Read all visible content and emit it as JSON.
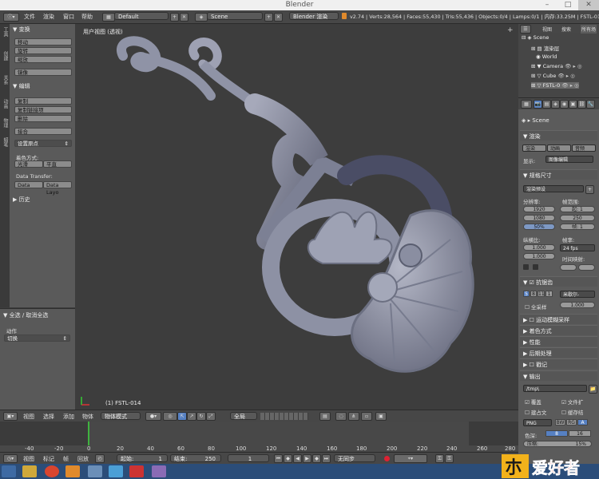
{
  "window": {
    "title": "Blender"
  },
  "info_header": {
    "menus": [
      "文件",
      "渲染",
      "窗口",
      "帮助"
    ],
    "screen_layout": "Default",
    "scene": "Scene",
    "render_engine": "Blender 渲染",
    "stats": "v2.74 | Verts:28,564 | Faces:55,430 | Tris:55,436 | Objects:0/4 | Lamps:0/1 | 内存:33.25M | FSTL-014"
  },
  "toolshelf": {
    "tabs": [
      "工具",
      "创建",
      "关系",
      "动画",
      "物理",
      "蜡笔"
    ],
    "transform": {
      "header": "变换",
      "buttons": [
        "移动",
        "旋转",
        "缩放"
      ],
      "mirror": "镜像"
    },
    "edit": {
      "header": "编辑",
      "buttons": [
        "复制",
        "复制链接项",
        "删除"
      ],
      "join": "接合",
      "set_origin": "设置原点",
      "shading_label": "着色方式:",
      "smooth": "光滑",
      "flat": "平直",
      "data_transfer_label": "Data Transfer:",
      "data": "Data",
      "data_layout": "Data Layo"
    },
    "history": {
      "header": "历史"
    }
  },
  "operator": {
    "title": "全选 / 取消全选",
    "action_label": "动作",
    "action_value": "切换"
  },
  "viewport": {
    "title": "用户视图 (透视)",
    "object_label": "(1) FSTL-014"
  },
  "viewport_header": {
    "menus": [
      "视图",
      "选择",
      "添加",
      "物体"
    ],
    "mode": "物体模式",
    "pivot": "全局"
  },
  "timeline": {
    "ticks": [
      "-40",
      "-20",
      "0",
      "20",
      "40",
      "60",
      "80",
      "100",
      "120",
      "140",
      "160",
      "180",
      "200",
      "220",
      "240",
      "260",
      "280"
    ],
    "menus": [
      "视图",
      "标记",
      "帧",
      "回放"
    ],
    "start_label": "起始:",
    "start": "1",
    "end_label": "结束:",
    "end": "250",
    "current": "1",
    "sync": "无同步"
  },
  "outliner": {
    "tabs": [
      "视图",
      "搜索",
      "所有场"
    ],
    "items": [
      "Scene",
      "渲染层",
      "World",
      "Camera",
      "Cube",
      "FSTL-0"
    ]
  },
  "properties": {
    "scene_label": "Scene",
    "render_header": "渲染",
    "render_buttons": [
      "渲染",
      "动画",
      "音频"
    ],
    "display_label": "显示:",
    "display_value": "图像编辑",
    "dimensions_header": "规格尺寸",
    "presets": "渲染预设",
    "resolution_label": "分辨率:",
    "res_x": "1920",
    "res_y": "1080",
    "res_pct": "50%",
    "frame_range_label": "帧范围:",
    "start": "起: 1",
    "end": "250",
    "step": "帧: 1",
    "aspect_label": "纵横比:",
    "aspect_x": "1.000",
    "aspect_y": "1.000",
    "framerate_label": "帧率:",
    "fps": "24 fps",
    "time_remap": "时间映射:",
    "aa_header": "抗锯齿",
    "aa_samples": [
      "5",
      "8",
      "11",
      "1"
    ],
    "aa_filter": "米歇尔-",
    "full_sample": "全采样",
    "filter_size": "1.000",
    "sections": [
      "运动模糊采样",
      "着色方式",
      "性能",
      "后期处理",
      "戳记"
    ],
    "output_header": "输出",
    "output_path": "/tmp\\",
    "overwrite": "覆盖",
    "file_ext": "文件扩",
    "placeholders": "建占文",
    "cache": "缓存结",
    "format": "PNG",
    "color_mode": "BW",
    "rgb": "RG",
    "color_depth_label": "色深:",
    "depth_8": "8",
    "depth_16": "16",
    "compression_label": "压缩:",
    "compression": "15%"
  },
  "colors": {
    "mesh": "#8f93a6",
    "viewport_bg": "#3d3d3d",
    "accent": "#5680c2",
    "taskbar": "#2b4d79"
  }
}
